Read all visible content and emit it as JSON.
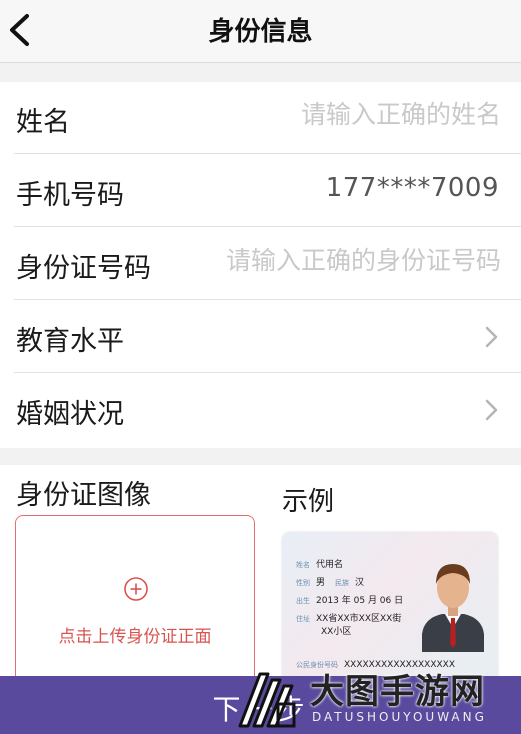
{
  "nav": {
    "title": "身份信息",
    "back_icon": "chevron-left-icon"
  },
  "form": {
    "name": {
      "label": "姓名",
      "placeholder": "请输入正确的姓名"
    },
    "phone": {
      "label": "手机号码",
      "value": "177****7009"
    },
    "id_number": {
      "label": "身份证号码",
      "placeholder": "请输入正确的身份证号码"
    },
    "education": {
      "label": "教育水平",
      "icon": "chevron-right-icon"
    },
    "marriage": {
      "label": "婚姻状况",
      "icon": "chevron-right-icon"
    }
  },
  "id_image": {
    "label": "身份证图像",
    "example_label": "示例",
    "upload_text": "点击上传身份证正面",
    "upload_icon": "plus-circle-icon",
    "sample": {
      "name_key": "姓名",
      "name_value": "代用名",
      "gender_key": "性别",
      "gender_value": "男",
      "ethnicity_key": "民族",
      "ethnicity_value": "汉",
      "birth_key": "出生",
      "birth_value": "2013 年 05 月 06 日",
      "address_key": "住址",
      "address_line1": "XX省XX市XX区XX街",
      "address_line2": "XX小区",
      "id_key": "公民身份号码",
      "id_value": "XXXXXXXXXXXXXXXXXX"
    }
  },
  "bottom": {
    "label": "下一步"
  },
  "watermark": {
    "text": "大图手游网",
    "sub": "DATUSHOUYOUWANG"
  },
  "colors": {
    "accent_red": "#d9534f",
    "button_purple": "#5a4a9e",
    "placeholder_gray": "#c9c9c9"
  }
}
